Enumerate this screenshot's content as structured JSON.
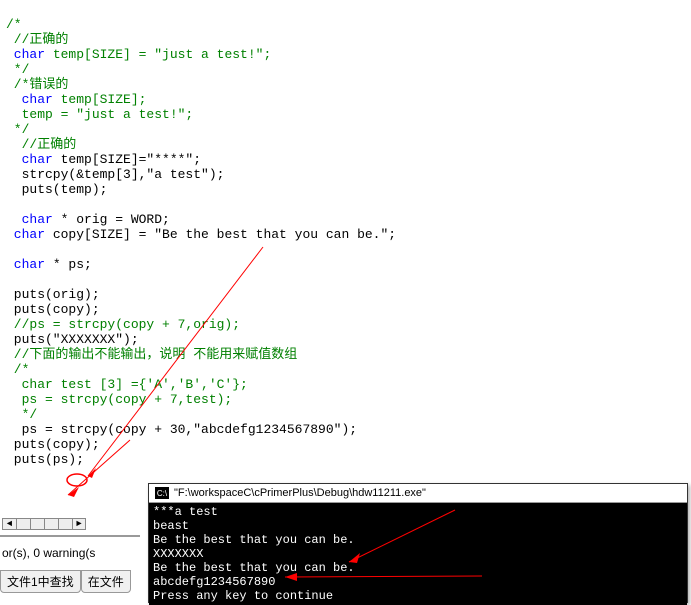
{
  "code": {
    "l1": "/*",
    "l2": " //正确的",
    "l3a": " char",
    "l3b": " temp[SIZE] = \"just a test!\";",
    "l4": " */",
    "l5": " /*错误的",
    "l6a": "  char",
    "l6b": " temp[SIZE];",
    "l7": "  temp = \"just a test!\";",
    "l8": " */",
    "l9": "  //正确的",
    "l10a": "  char",
    "l10b": " temp[SIZE]=\"****\";",
    "l11": "  strcpy(&temp[3],\"a test\");",
    "l12": "  puts(temp);",
    "l13": "",
    "l14a": "  char",
    "l14b": " * orig = WORD;",
    "l15a": " char",
    "l15b": " copy[SIZE] = \"Be the best that you can be.\";",
    "l16": "",
    "l17a": " char",
    "l17b": " * ps;",
    "l18": "",
    "l19": " puts(orig);",
    "l20": " puts(copy);",
    "l21": " //ps = strcpy(copy + 7,orig);",
    "l22": " puts(\"XXXXXXX\");",
    "l23": " //下面的输出不能输出，说明 不能用来赋值数组",
    "l24": " /*",
    "l25": "  char test [3] ={'A','B','C'};",
    "l26": "  ps = strcpy(copy + 7,test);",
    "l27": "  */",
    "l28": "  ps = strcpy(copy + 30,\"abcdefg1234567890\");",
    "l29": " puts(copy);",
    "l30": " puts(ps);"
  },
  "status": "or(s), 0 warning(s",
  "tabs": {
    "t1": "文件1中查找",
    "t2": "在文件"
  },
  "console": {
    "title": "\"F:\\workspaceC\\cPrimerPlus\\Debug\\hdw11211.exe\"",
    "line1": "***a test",
    "line2": "beast",
    "line3": "Be the best that you can be.",
    "line4": "XXXXXXX",
    "line5": "Be the best that you can be.",
    "line6": "abcdefg1234567890",
    "line7": "Press any key to continue"
  },
  "ruler_marks": [
    "◄",
    "",
    "",
    "",
    "",
    "►"
  ]
}
